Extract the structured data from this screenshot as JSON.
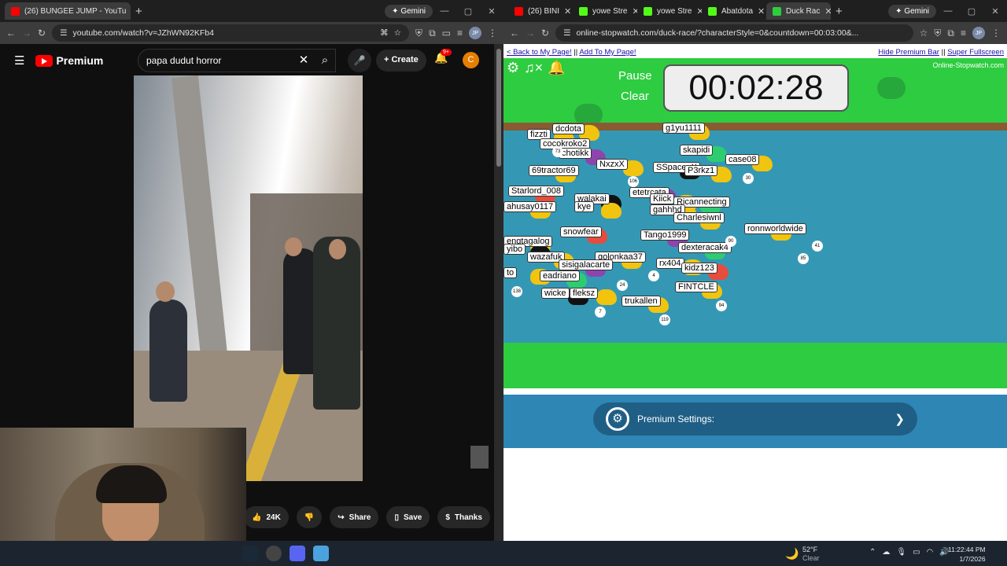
{
  "left_window": {
    "tab_title": "(26) BUNGEE JUMP - YouTu",
    "new_tab": "+",
    "gemini": "✦ Gemini",
    "url": "youtube.com/watch?v=JZhWN92KFb4",
    "avatar": "JP"
  },
  "right_window": {
    "tabs": [
      "(26) BINI",
      "yowe Stre",
      "yowe Stre",
      "Abatdota",
      "Duck Rac"
    ],
    "gemini": "✦ Gemini",
    "url": "online-stopwatch.com/duck-race/?characterStyle=0&countdown=00:03:00&...",
    "avatar": "JP"
  },
  "youtube": {
    "logo_text": "Premium",
    "search_value": "papa dudut horror",
    "create_label": "Create",
    "notif_count": "9+",
    "user_initial": "C",
    "like_count": "24K",
    "share_label": "Share",
    "save_label": "Save",
    "thanks_label": "Thanks"
  },
  "duckrace": {
    "back_link": "< Back to My Page!",
    "add_link": "Add To My Page!",
    "sep": "||",
    "hide_link": "Hide Premium Bar",
    "full_link": "Super Fullscreen",
    "pause": "Pause",
    "clear": "Clear",
    "timer": "00:02:28",
    "brand": "Online-Stopwatch.com",
    "premium_settings": "Premium Settings:",
    "ducks": [
      "dcdota",
      "fizzti",
      "cocokroko2",
      "chotikk",
      "g1yu1111",
      "skapidi",
      "NxzxX",
      "SSpace_X",
      "P3rkz1",
      "case08",
      "69tractor69",
      "Starlord_008",
      "etetrcata",
      "Kiick",
      "Ricannecting",
      "gahhhd",
      "walakai",
      "ahusay0117",
      "kye",
      "Charlesiwnl",
      "snowfear",
      "Tango1999",
      "ronnworldwide",
      "dexteracak4",
      "engtagalog",
      "yibo",
      "wazafuk",
      "golonkaa37",
      "rx404",
      "kidz123",
      "sisigalacarte",
      "to",
      "eadriano",
      "FINTCLE",
      "wicke",
      "fleksz",
      "trukallen"
    ],
    "numbers": [
      "73",
      "106",
      "30",
      "138",
      "24",
      "4",
      "94",
      "85",
      "41",
      "7",
      "119",
      "90"
    ]
  },
  "taskbar": {
    "temp": "52°F",
    "cond": "Clear",
    "time": "11:22:44 PM",
    "date": "1/7/2026"
  }
}
